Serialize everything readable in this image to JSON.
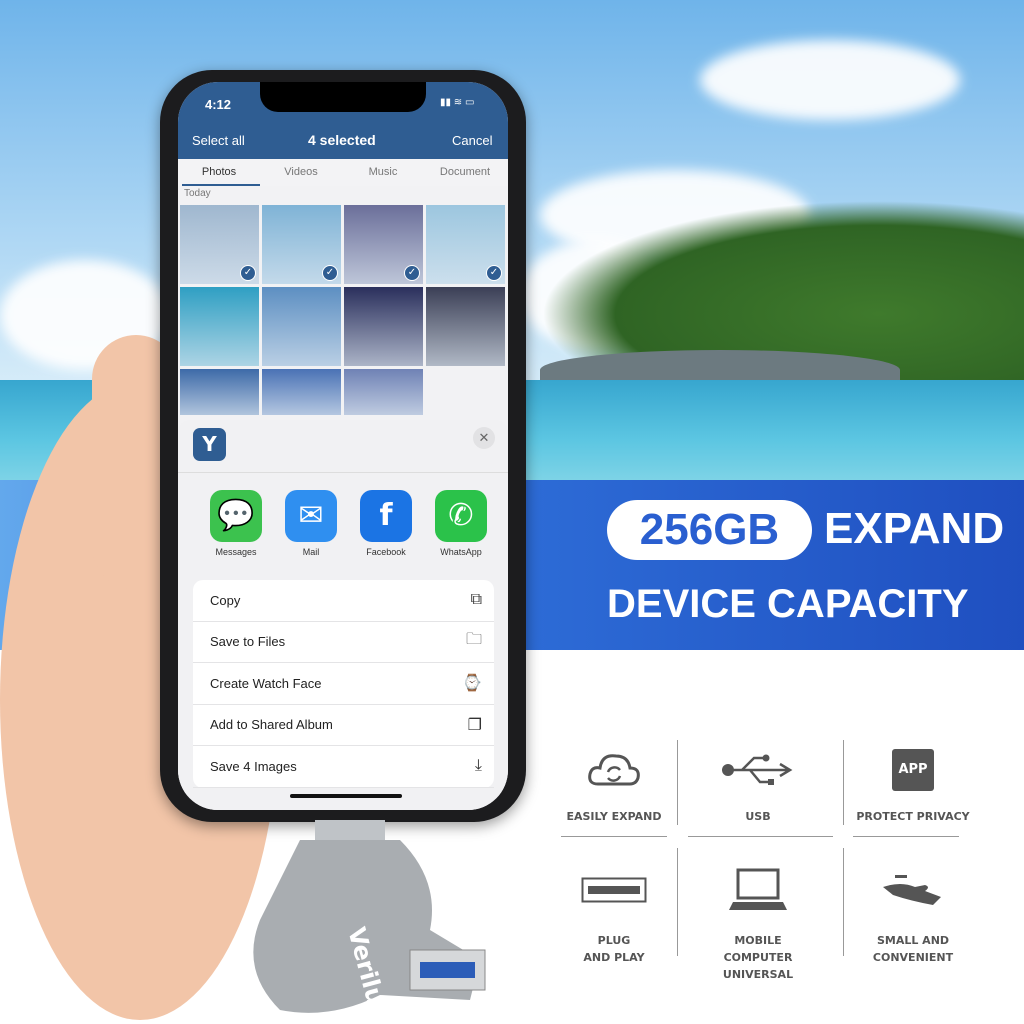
{
  "banner": {
    "capacity": "256GB",
    "headline1": "EXPAND",
    "headline2": "DEVICE CAPACITY"
  },
  "brand_logo": "Verilux",
  "phone": {
    "status": {
      "time": "4:12"
    },
    "header": {
      "left": "Select all",
      "title": "4 selected",
      "right": "Cancel"
    },
    "tabs": [
      {
        "label": "Photos",
        "active": true
      },
      {
        "label": "Videos"
      },
      {
        "label": "Music"
      },
      {
        "label": "Document"
      }
    ],
    "section": "Today",
    "photos": [
      {
        "selected": true,
        "color": "#9fb7cf"
      },
      {
        "selected": true,
        "color": "#7fb3d6"
      },
      {
        "selected": true,
        "color": "#6b6f9a"
      },
      {
        "selected": true,
        "color": "#9cc6df"
      },
      {
        "selected": false,
        "color": "#2f9fc3"
      },
      {
        "selected": false,
        "color": "#5d8fc2"
      },
      {
        "selected": false,
        "color": "#2a2f5c"
      },
      {
        "selected": false,
        "color": "#3b3f56"
      },
      {
        "selected": false,
        "color": "#3d6aa8"
      },
      {
        "selected": false,
        "color": "#4a72b5"
      },
      {
        "selected": false,
        "color": "#6f82b5"
      }
    ],
    "share": {
      "apps": [
        {
          "label": "Messages",
          "icon": "messages-icon",
          "color": "#3cc24e"
        },
        {
          "label": "Mail",
          "icon": "mail-icon",
          "color": "#2f8ff0"
        },
        {
          "label": "Facebook",
          "icon": "facebook-icon",
          "color": "#1b74e4"
        },
        {
          "label": "WhatsApp",
          "icon": "whatsapp-icon",
          "color": "#2bc24a"
        }
      ],
      "actions": [
        {
          "label": "Copy",
          "icon": "copy-icon"
        },
        {
          "label": "Save to Files",
          "icon": "folder-icon"
        },
        {
          "label": "Create Watch Face",
          "icon": "watch-icon"
        },
        {
          "label": "Add to Shared Album",
          "icon": "shared-album-icon"
        },
        {
          "label": "Save 4 Images",
          "icon": "save-icon"
        }
      ]
    }
  },
  "features": [
    {
      "label": "EASILY EXPAND",
      "icon": "cloud-sync-icon"
    },
    {
      "label": "USB",
      "icon": "usb-icon"
    },
    {
      "label": "PROTECT PRIVACY",
      "icon": "app-icon",
      "icon_text": "APP"
    },
    {
      "label": "PLUG\nAND PLAY",
      "icon": "usb-port-icon"
    },
    {
      "label": "MOBILE\nCOMPUTER UNIVERSAL",
      "icon": "laptop-icon"
    },
    {
      "label": "SMALL AND\nCONVENIENT",
      "icon": "hand-icon"
    }
  ]
}
